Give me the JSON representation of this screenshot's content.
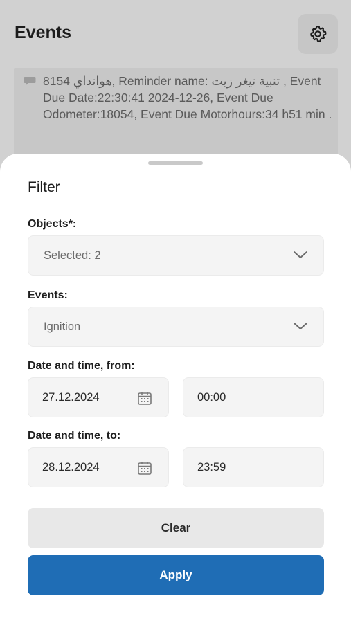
{
  "header": {
    "title": "Events"
  },
  "event": {
    "text": "8154 هوانداي, Reminder name: تنبية تيغر زيت , Event Due Date:22:30:41 2024-12-26, Event Due Odometer:18054, Event Due Motorhours:34 h51 min ."
  },
  "filter": {
    "title": "Filter",
    "objects": {
      "label": "Objects*:",
      "value": "Selected: 2"
    },
    "events": {
      "label": "Events:",
      "value": "Ignition"
    },
    "from": {
      "label": "Date and time, from:",
      "date": "27.12.2024",
      "time": "00:00"
    },
    "to": {
      "label": "Date and time, to:",
      "date": "28.12.2024",
      "time": "23:59"
    },
    "clear_label": "Clear",
    "apply_label": "Apply"
  },
  "icons": {
    "settings": "gear-icon",
    "comment": "comment-icon",
    "chevron": "chevron-down-icon",
    "calendar": "calendar-icon"
  },
  "colors": {
    "apply": "#1f6db5",
    "overlay": "#d1d1d1"
  }
}
